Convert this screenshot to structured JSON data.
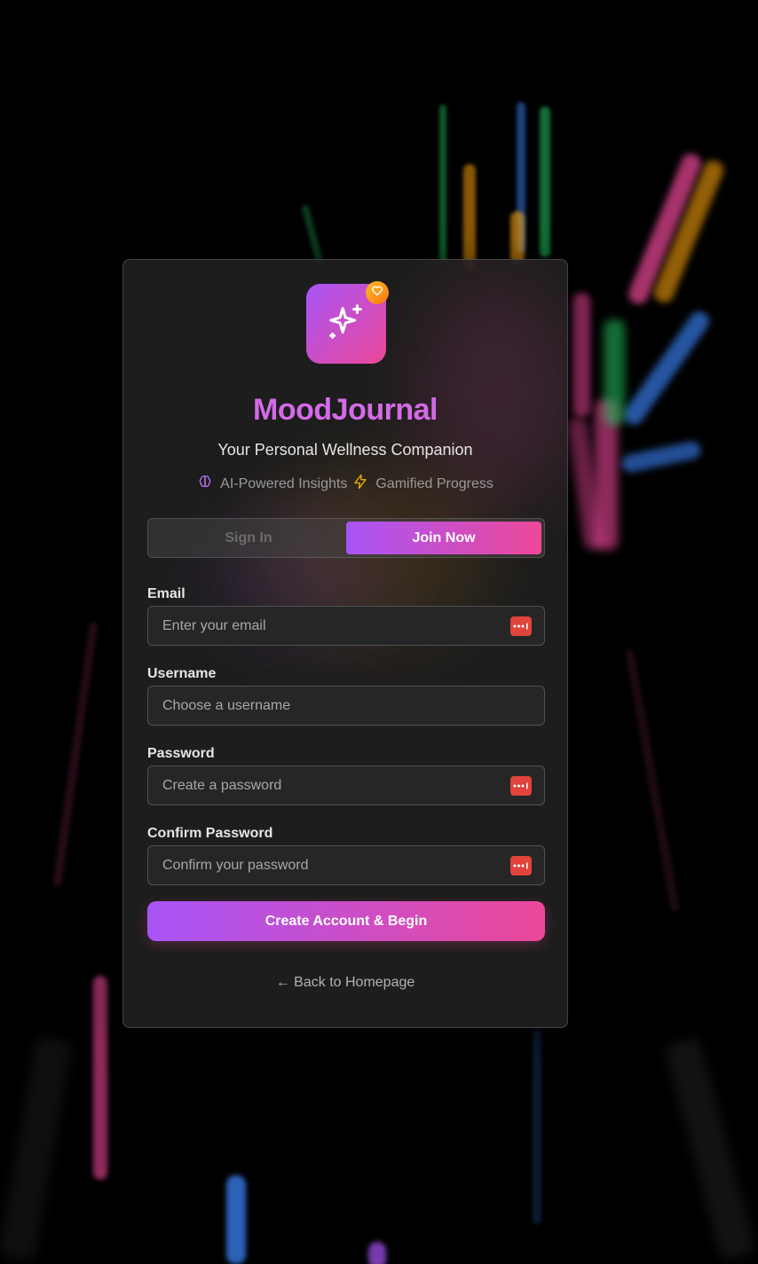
{
  "app": {
    "title": "MoodJournal",
    "subtitle": "Your Personal Wellness Companion",
    "badge_icon": "heart-icon",
    "logo_icon": "sparkles-icon"
  },
  "features": [
    {
      "icon": "brain-icon",
      "label": "AI-Powered Insights"
    },
    {
      "icon": "lightning-icon",
      "label": "Gamified Progress"
    }
  ],
  "tabs": {
    "signin_label": "Sign In",
    "join_label": "Join Now",
    "active": "join"
  },
  "form": {
    "email_label": "Email",
    "email_placeholder": "Enter your email",
    "username_label": "Username",
    "username_placeholder": "Choose a username",
    "password_label": "Password",
    "password_placeholder": "Create a password",
    "confirm_label": "Confirm Password",
    "confirm_placeholder": "Confirm your password",
    "submit_label": "Create Account & Begin"
  },
  "back_link": "← Back to Homepage",
  "colors": {
    "accent_start": "#a855f7",
    "accent_end": "#ec4899",
    "title": "#d36be6",
    "badge": "#f59e0b",
    "password_manager_icon": "#e0443a"
  }
}
